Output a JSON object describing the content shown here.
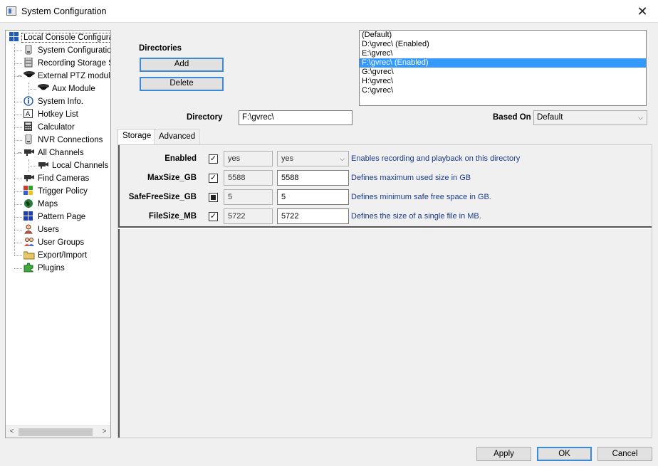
{
  "window": {
    "title": "System Configuration",
    "close_glyph": "✕"
  },
  "tree": {
    "items": [
      {
        "label": "Local Console Configurati",
        "icon": "windows-grid-icon"
      },
      {
        "label": "System Configuration",
        "icon": "drive-icon"
      },
      {
        "label": "Recording Storage Se",
        "icon": "storage-icon"
      },
      {
        "label": "External PTZ module",
        "icon": "ptz-camera-icon"
      },
      {
        "label": "Aux Module",
        "icon": "dome-camera-icon"
      },
      {
        "label": "System Info.",
        "icon": "info-icon"
      },
      {
        "label": "Hotkey List",
        "icon": "hotkey-icon"
      },
      {
        "label": "Calculator",
        "icon": "calculator-icon"
      },
      {
        "label": "NVR Connections",
        "icon": "nvr-icon"
      },
      {
        "label": "All Channels",
        "icon": "camera-icon"
      },
      {
        "label": "Local Channels",
        "icon": "camera-icon"
      },
      {
        "label": "Find Cameras",
        "icon": "camera-icon"
      },
      {
        "label": "Trigger Policy",
        "icon": "trigger-icon"
      },
      {
        "label": "Maps",
        "icon": "globe-icon"
      },
      {
        "label": "Pattern Page",
        "icon": "pattern-grid-icon"
      },
      {
        "label": "Users",
        "icon": "user-icon"
      },
      {
        "label": "User Groups",
        "icon": "user-group-icon"
      },
      {
        "label": "Export/Import",
        "icon": "folder-icon"
      },
      {
        "label": "Plugins",
        "icon": "puzzle-icon"
      }
    ],
    "scroll_left": "<",
    "scroll_right": ">"
  },
  "directories": {
    "section_label": "Directories",
    "add_label": "Add",
    "delete_label": "Delete",
    "list": [
      {
        "text": "(Default)",
        "selected": false
      },
      {
        "text": "D:\\gvrec\\ (Enabled)",
        "selected": false
      },
      {
        "text": "E:\\gvrec\\",
        "selected": false
      },
      {
        "text": "F:\\gvrec\\ (Enabled)",
        "selected": true
      },
      {
        "text": "G:\\gvrec\\",
        "selected": false
      },
      {
        "text": "H:\\gvrec\\",
        "selected": false
      },
      {
        "text": "C:\\gvrec\\",
        "selected": false
      }
    ],
    "directory_label": "Directory",
    "directory_value": "F:\\gvrec\\",
    "based_on_label": "Based On",
    "based_on_value": "Default"
  },
  "tabs": [
    {
      "label": "Storage",
      "active": true
    },
    {
      "label": "Advanced",
      "active": false
    }
  ],
  "settings": [
    {
      "label": "Enabled",
      "checkbox": "checked",
      "inherited": "yes",
      "value": "yes",
      "value_is_combo": true,
      "description": "Enables recording and playback on this directory"
    },
    {
      "label": "MaxSize_GB",
      "checkbox": "checked",
      "inherited": "5588",
      "value": "5588",
      "value_is_combo": false,
      "description": "Defines maximum used size in GB"
    },
    {
      "label": "SafeFreeSize_GB",
      "checkbox": "indeterminate",
      "inherited": "5",
      "value": "5",
      "value_is_combo": false,
      "description": "Defines minimum safe free space in GB."
    },
    {
      "label": "FileSize_MB",
      "checkbox": "checked",
      "inherited": "5722",
      "value": "5722",
      "value_is_combo": false,
      "description": "Defines the size of a single file in MB."
    }
  ],
  "footer": {
    "apply_label": "Apply",
    "ok_label": "OK",
    "cancel_label": "Cancel"
  },
  "colors": {
    "selection": "#3399ff",
    "focus_border": "#3c8ad6",
    "description_text": "#1a3a8a"
  }
}
